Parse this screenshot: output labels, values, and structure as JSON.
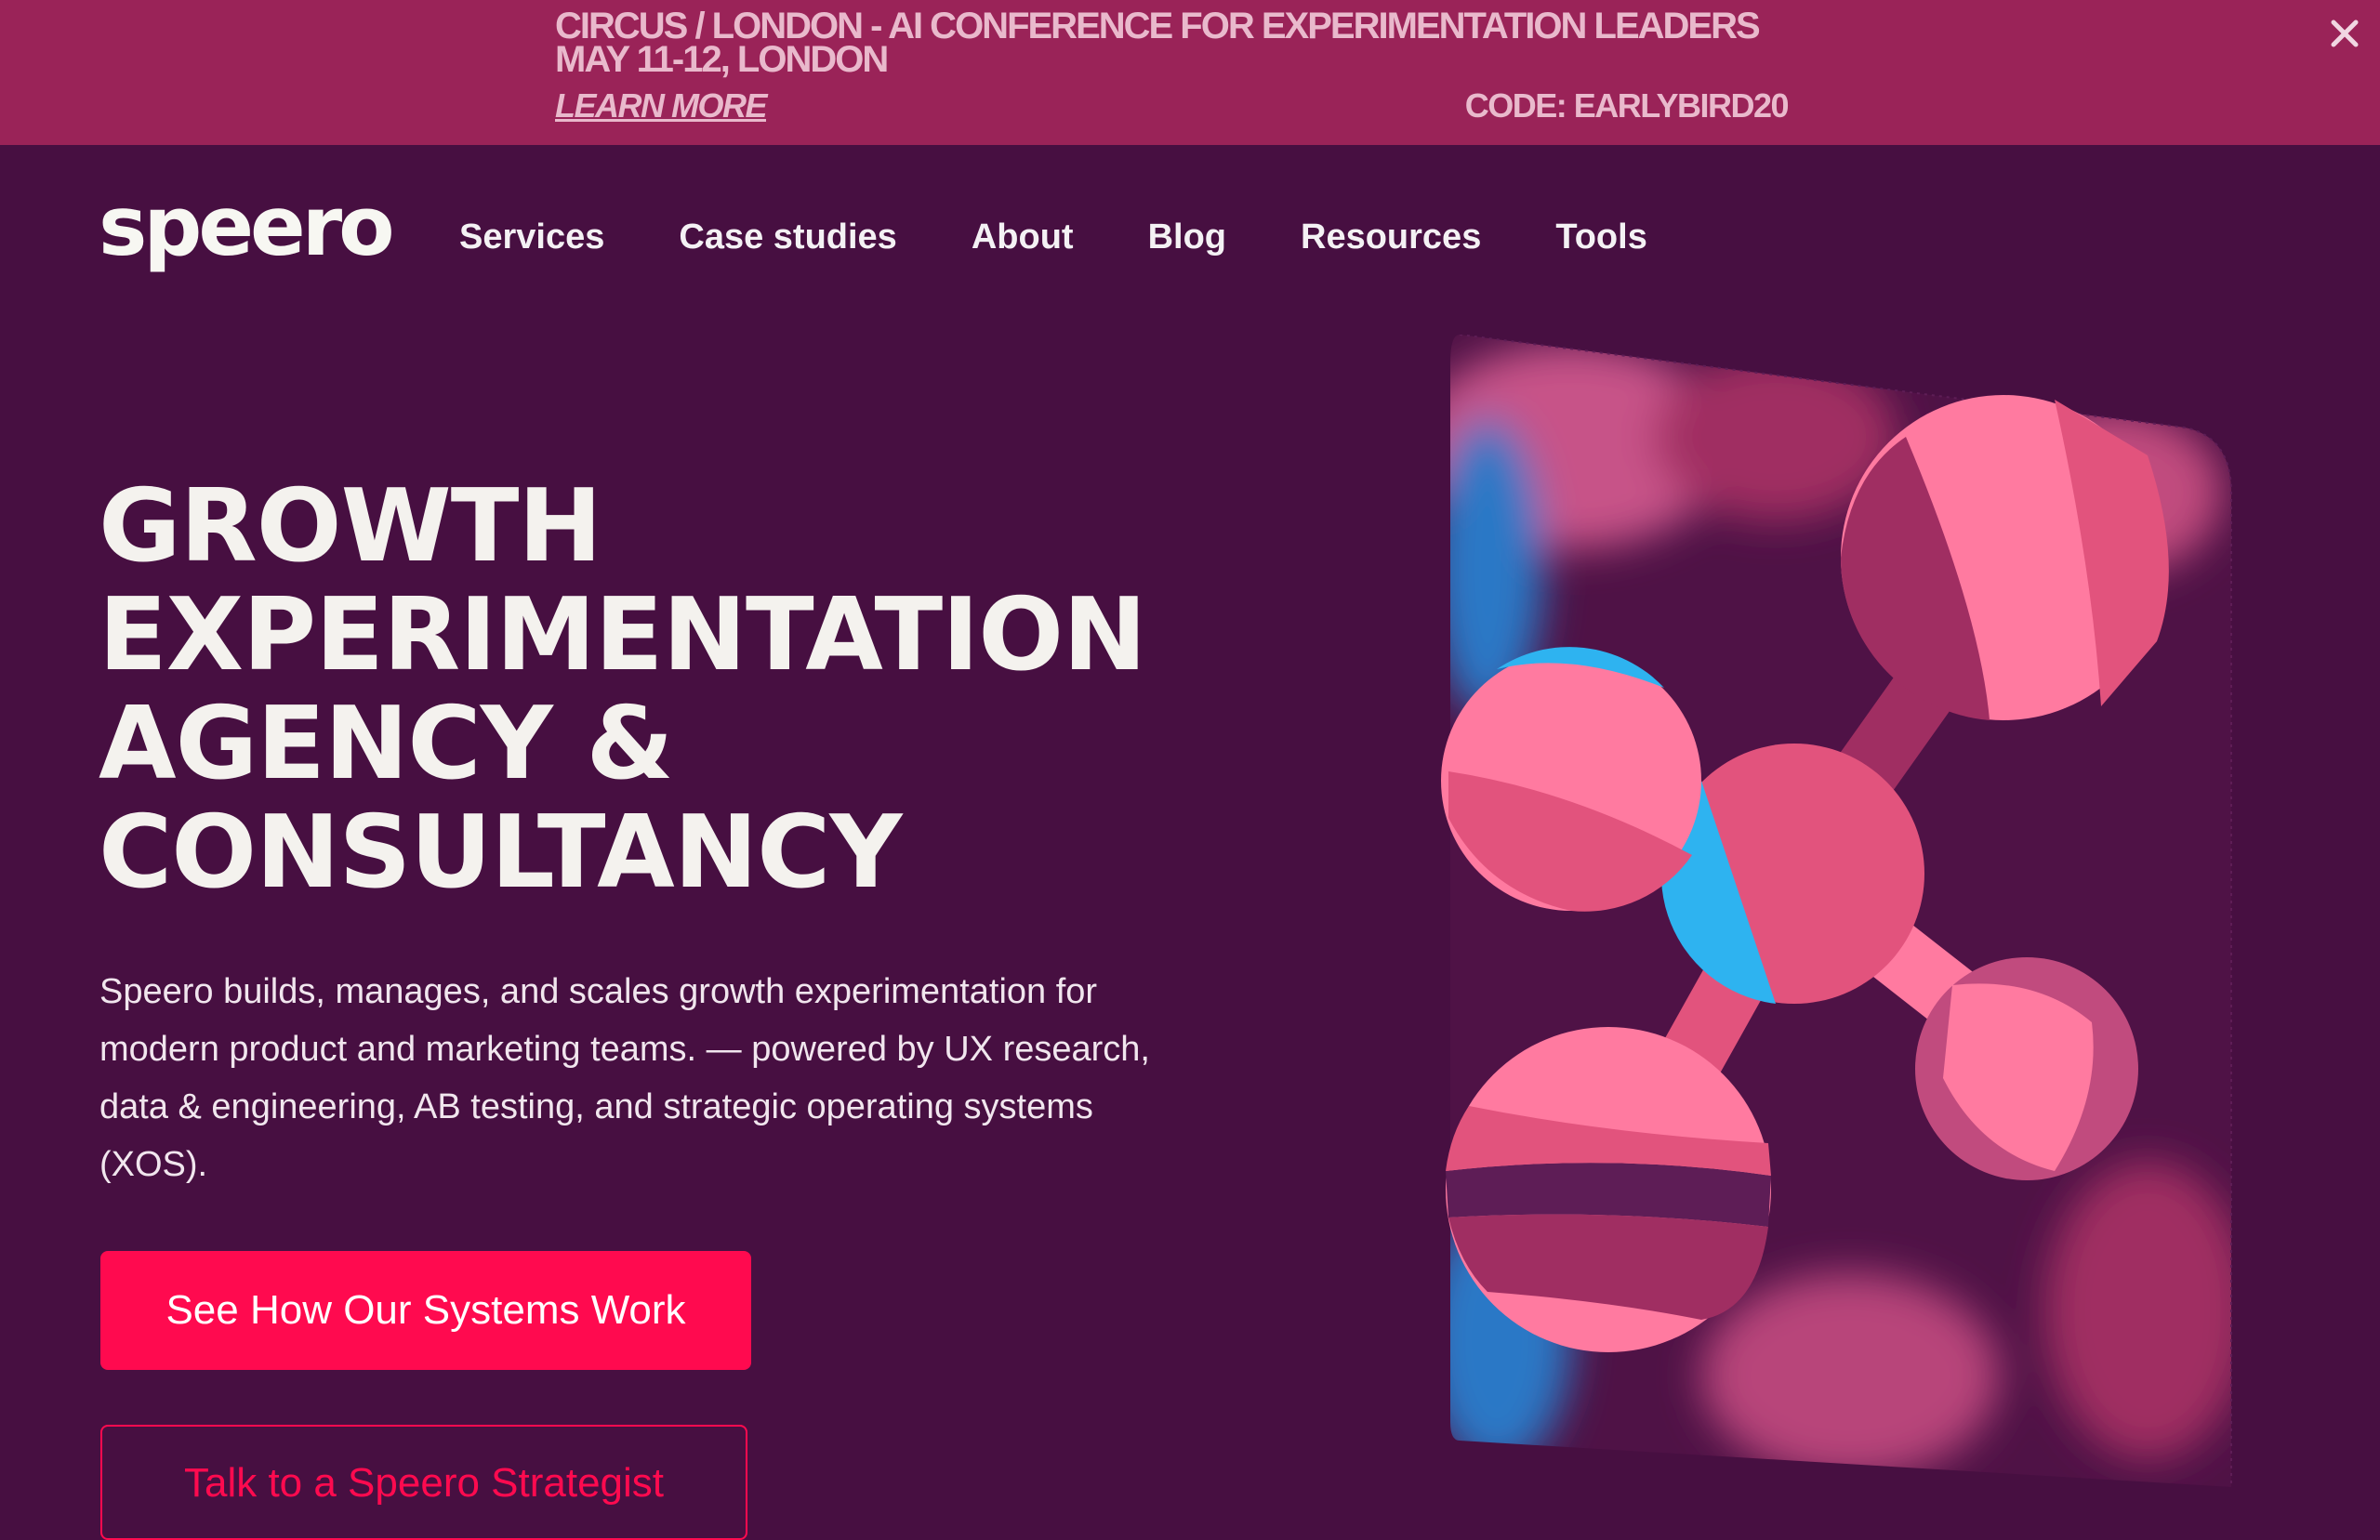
{
  "banner": {
    "title": "CIRCUS / LONDON - AI CONFERENCE FOR EXPERIMENTATION LEADERS",
    "date": "MAY 11-12, LONDON",
    "link": "LEARN MORE",
    "code": "CODE: EARLYBIRD20"
  },
  "logo": "speero",
  "nav": [
    "Services",
    "Case studies",
    "About",
    "Blog",
    "Resources",
    "Tools"
  ],
  "hero": {
    "title_lines": [
      "GROWTH",
      "EXPERIMENTATION",
      "AGENCY &",
      "CONSULTANCY"
    ],
    "description": "Speero builds, manages, and scales growth experimentation for modern product and marketing teams. — powered by UX research, data & engineering, AB testing, and strategic operating systems (XOS).",
    "primary_cta": "See How Our Systems Work",
    "secondary_cta": "Talk to a Speero Strategist"
  },
  "colors": {
    "background": "#470f41",
    "banner": "#9a2358",
    "accent": "#ff0a4f",
    "pink": "#ff7aa0",
    "blue": "#2eb3f0"
  },
  "icons": {
    "close": "close-icon",
    "illustration": "molecule-illustration"
  }
}
